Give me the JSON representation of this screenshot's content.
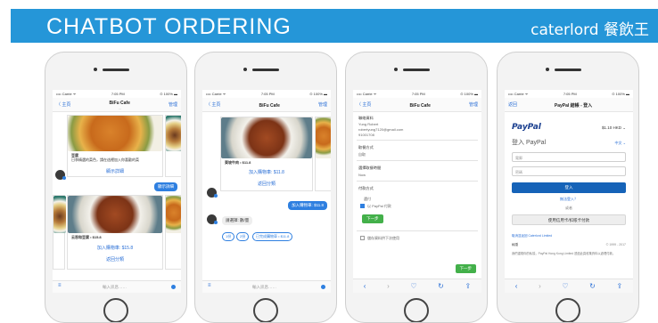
{
  "banner": {
    "title": "CHATBOT ORDERING",
    "brand": "caterlord 餐飲王"
  },
  "phone1": {
    "status_left": "•••• Carrie ᯤ",
    "status_time": "7:05 PM",
    "status_right": "⊙ 100% ▬",
    "back": "〈 主頁",
    "title": "BiFu Cafe",
    "subtitle": "…",
    "right": "管理",
    "dish1_name": "豆腐",
    "dish1_desc": "日季精選的菜色，請在這裡加入你喜歡的菜",
    "dish1_link": "顯示詳細",
    "bubble_user": "顯示詳細",
    "dish2_name": "云吞和豆腐 • $15.8",
    "dish2_add": "加入購物車: $15.8",
    "dish2_detail": "返回分類",
    "input_placeholder": "輸入訊息……"
  },
  "phone2": {
    "status_time": "7:05 PM",
    "back": "〈 主頁",
    "title": "BiFu Cafe",
    "right": "管理",
    "dish_name": "東坡牛肉 • $11.8",
    "dish_add": "加入購物車: $11.8",
    "dish_detail": "返回分類",
    "bubble_user": "加入購物車: $11.8",
    "bot_text": "請選擇: 數/量",
    "pill1": "1份",
    "pill2": "2份",
    "pill3": "已完成購物車 • $11.8",
    "input_placeholder": "輸入訊息……"
  },
  "phone3": {
    "status_time": "7:05 PM",
    "back": "〈 主頁",
    "title": "BiFu Cafe",
    "right": "管理",
    "section1": "聯絡資料",
    "name": "Yung Robert",
    "email": "robertyung7120@gmail.com",
    "phone": "91001708",
    "section2": "取餐方式",
    "pickup": "自取",
    "section3": "選擇取餐時間",
    "time": "Now",
    "section4": "付款方式",
    "pay_label": "選付",
    "pay_option": "以 PayPal 付款",
    "next_btn": "下一步",
    "remember": "儲存資料供下次使用",
    "submit_btn": "下一步"
  },
  "phone4": {
    "status_time": "7:05 PM",
    "back": "返回",
    "title": "PayPal 結帳 - 登入",
    "logo": "PayPal",
    "amount": "$1.10 HKD ⌄",
    "lang": "中文 ⌄",
    "login_title": "登入 PayPal",
    "email_ph": "電郵",
    "password_ph": "密碼",
    "login_btn": "登入",
    "forgot": "無法登入？",
    "or": "或者",
    "guest_btn": "使用信用卡/扣賬卡付款",
    "cancel_link": "取消並返回 Caterlord Limited",
    "footer_left": "私隱",
    "footer_right": "© 1999 - 2017",
    "footer_note": "我們重視你的私隱，PayPal Hong Kong Limited 透過此頁收集資料以處理付款。"
  },
  "colors": {
    "banner": "#2596d8",
    "accent": "#2e7fe0",
    "green": "#43b04a",
    "paypal": "#1663b8"
  }
}
